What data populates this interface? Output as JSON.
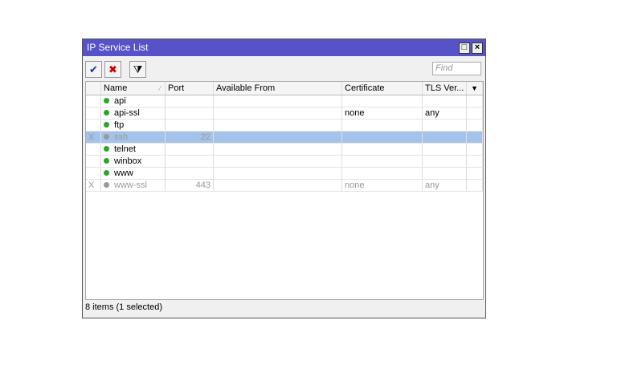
{
  "window": {
    "title": "IP Service List",
    "find_placeholder": "Find"
  },
  "toolbar": {
    "enable": "✔",
    "disable": "✖",
    "filter": "⧩"
  },
  "columns": [
    "Name",
    "Port",
    "Available From",
    "Certificate",
    "TLS Ver..."
  ],
  "rows": [
    {
      "flag": "",
      "name": "api",
      "port": "",
      "available_from": "",
      "certificate": "",
      "tls": "",
      "disabled": false,
      "selected": false
    },
    {
      "flag": "",
      "name": "api-ssl",
      "port": "",
      "available_from": "",
      "certificate": "none",
      "tls": "any",
      "disabled": false,
      "selected": false
    },
    {
      "flag": "",
      "name": "ftp",
      "port": "",
      "available_from": "",
      "certificate": "",
      "tls": "",
      "disabled": false,
      "selected": false
    },
    {
      "flag": "X",
      "name": "ssh",
      "port": "22",
      "available_from": "",
      "certificate": "",
      "tls": "",
      "disabled": true,
      "selected": true
    },
    {
      "flag": "",
      "name": "telnet",
      "port": "",
      "available_from": "",
      "certificate": "",
      "tls": "",
      "disabled": false,
      "selected": false
    },
    {
      "flag": "",
      "name": "winbox",
      "port": "",
      "available_from": "",
      "certificate": "",
      "tls": "",
      "disabled": false,
      "selected": false
    },
    {
      "flag": "",
      "name": "www",
      "port": "",
      "available_from": "",
      "certificate": "",
      "tls": "",
      "disabled": false,
      "selected": false
    },
    {
      "flag": "X",
      "name": "www-ssl",
      "port": "443",
      "available_from": "",
      "certificate": "none",
      "tls": "any",
      "disabled": true,
      "selected": false
    }
  ],
  "status": "8 items (1 selected)"
}
